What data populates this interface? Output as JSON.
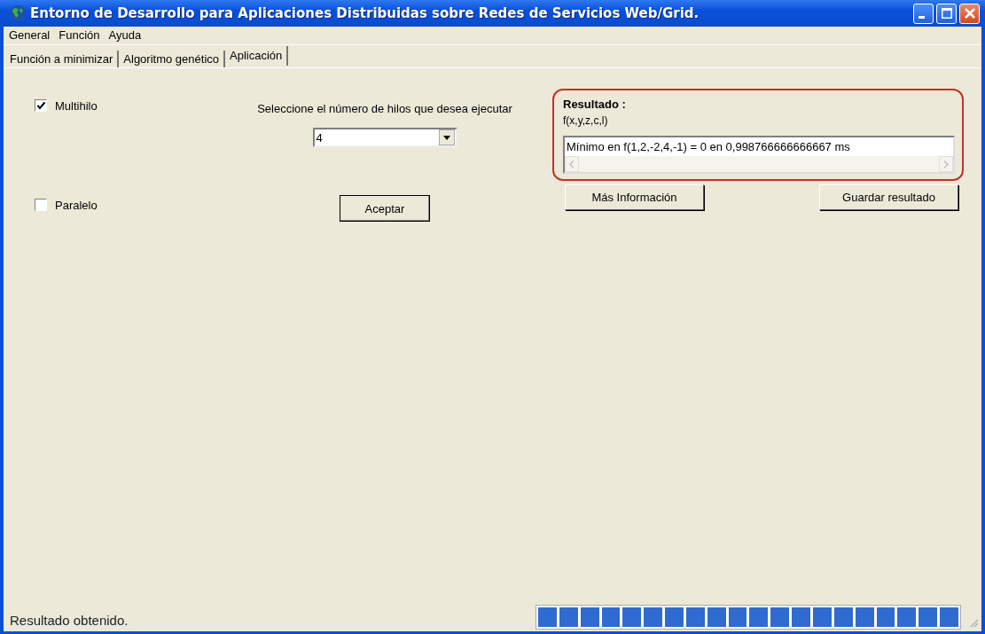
{
  "window": {
    "title": "Entorno de Desarrollo para Aplicaciones Distribuidas sobre Redes de Servicios Web/Grid."
  },
  "menu": [
    "General",
    "Función",
    "Ayuda"
  ],
  "tabs": [
    {
      "label": "Función a minimizar",
      "selected": false
    },
    {
      "label": "Algoritmo genético",
      "selected": false
    },
    {
      "label": "Aplicación",
      "selected": true
    }
  ],
  "options": [
    {
      "label": "Multihilo",
      "checked": true
    },
    {
      "label": "Paralelo",
      "checked": false
    }
  ],
  "threads": {
    "label": "Seleccione el número de hilos que desea ejecutar",
    "value": "4",
    "button": "Aceptar"
  },
  "result": {
    "title": "Resultado :",
    "function": "f(x,y,z,c,l)",
    "value": "Mínimo en f(1,2,-2,4,-1) = 0  en 0,998766666666667 ms",
    "buttons": [
      "Más Información",
      "Guardar resultado"
    ]
  },
  "status_bar": {
    "text": "Resultado obtenido.",
    "progress": {
      "level": 1
    }
  }
}
